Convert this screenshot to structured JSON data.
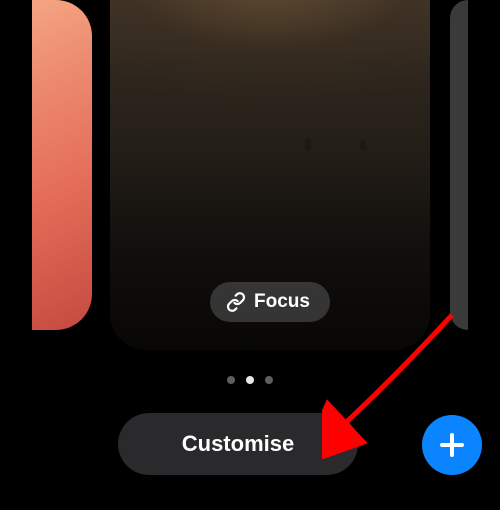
{
  "carousel": {
    "pages_total": 3,
    "active_index": 1
  },
  "focus": {
    "label": "Focus",
    "icon": "link-icon"
  },
  "buttons": {
    "customise_label": "Customise",
    "add_icon": "plus-icon"
  },
  "annotation": {
    "arrow_color": "#ff0000"
  }
}
